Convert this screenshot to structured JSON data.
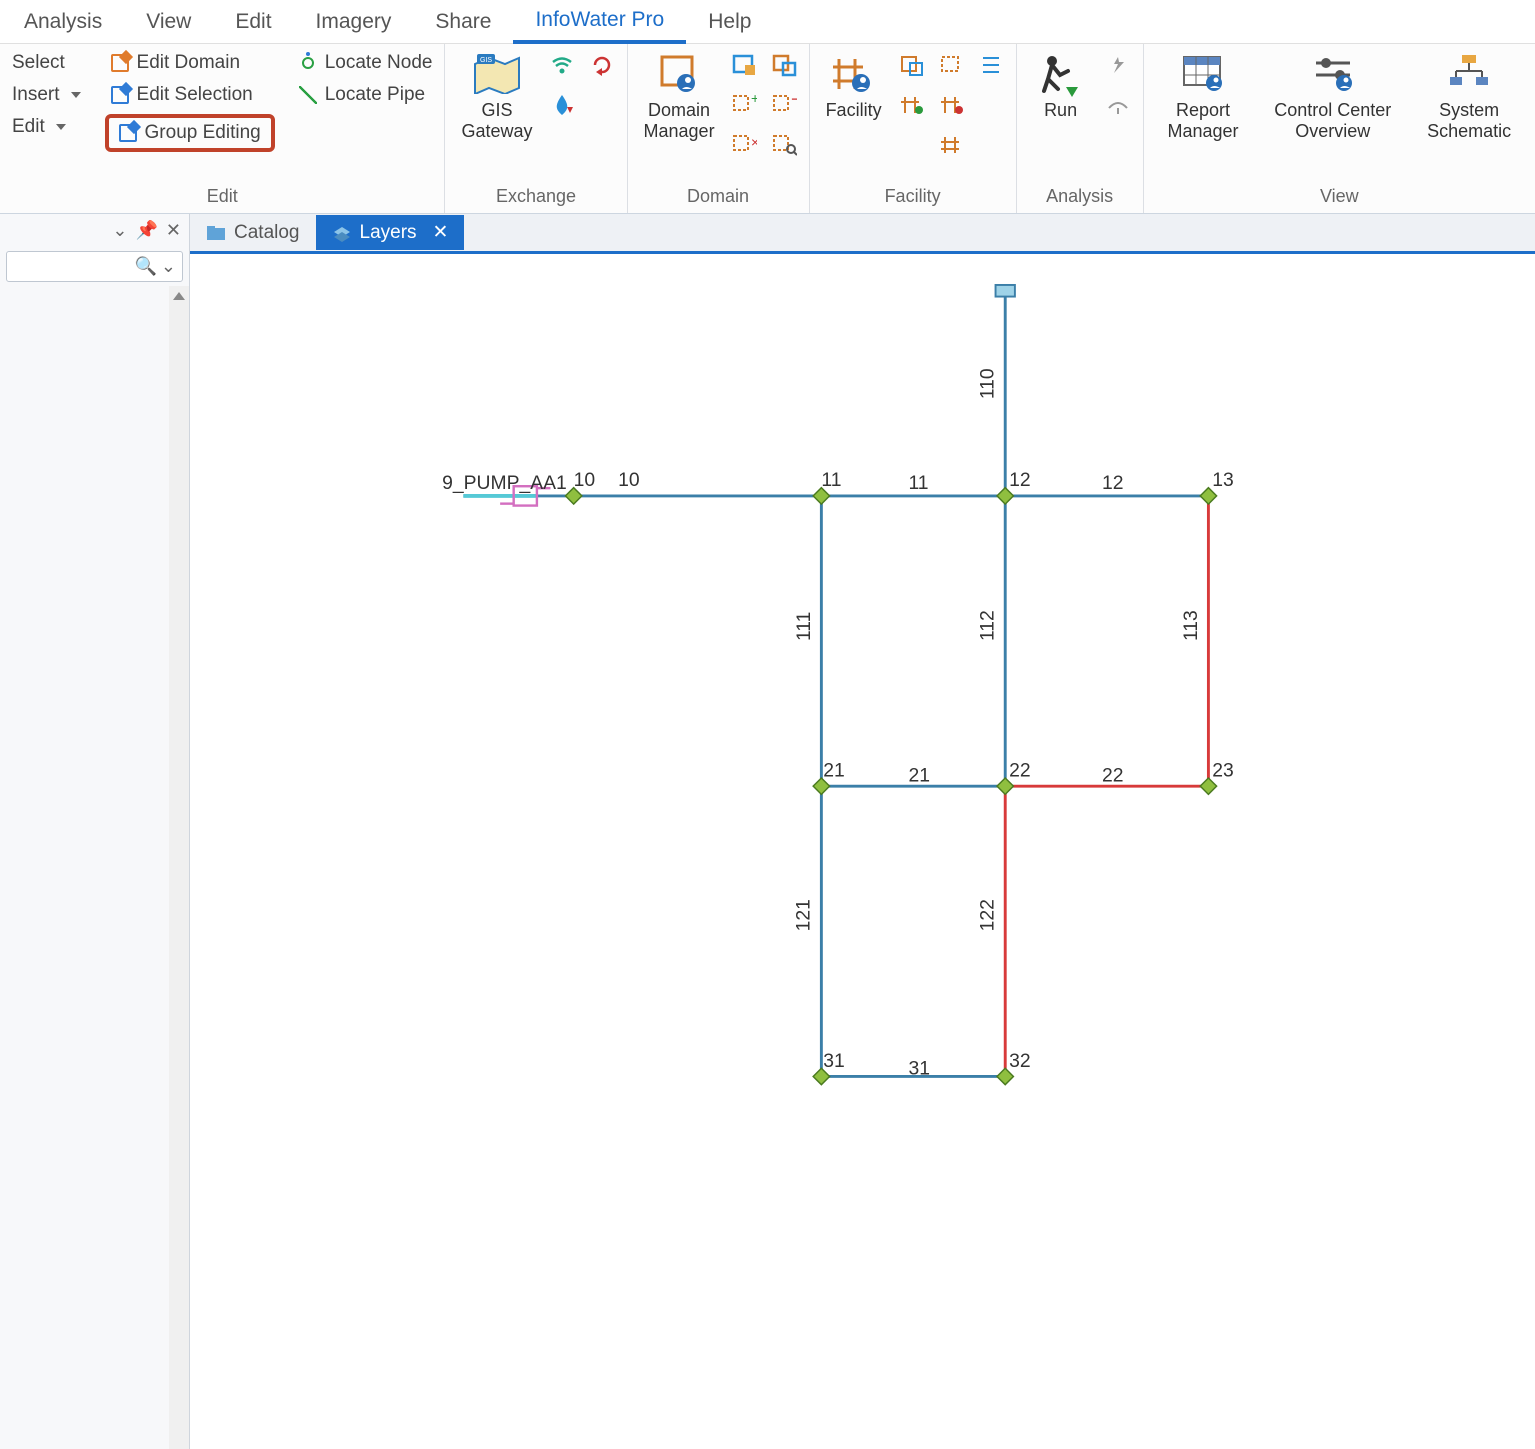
{
  "menu_tabs": {
    "analysis": "Analysis",
    "view": "View",
    "edit": "Edit",
    "imagery": "Imagery",
    "share": "Share",
    "infowater": "InfoWater Pro",
    "help": "Help"
  },
  "ribbon": {
    "edit_group": {
      "select": "Select",
      "insert": "Insert",
      "edit": "Edit",
      "edit_domain": "Edit Domain",
      "edit_selection": "Edit Selection",
      "group_editing": "Group Editing",
      "locate_node": "Locate Node",
      "locate_pipe": "Locate Pipe",
      "label": "Edit"
    },
    "exchange": {
      "gis_gateway": "GIS\nGateway",
      "label": "Exchange"
    },
    "domain": {
      "domain_manager": "Domain\nManager",
      "label": "Domain"
    },
    "facility": {
      "facility": "Facility",
      "label": "Facility"
    },
    "analysis": {
      "run": "Run",
      "label": "Analysis"
    },
    "view": {
      "report_manager": "Report\nManager",
      "control_center": "Control Center\nOverview",
      "system_schematic": "System\nSchematic",
      "label": "View"
    }
  },
  "doc_tabs": {
    "catalog": "Catalog",
    "layers": "Layers"
  },
  "side_panel": {
    "search_placeholder": ""
  },
  "network": {
    "pump_label": "9_PUMP_AA1",
    "nodes": {
      "n10a": "10",
      "n10b": "10",
      "n11": "11",
      "n12": "12",
      "n13": "13",
      "n21": "21",
      "n22": "22",
      "n23": "23",
      "n31": "31",
      "n32": "32"
    },
    "pipes": {
      "p110": "110",
      "p11": "11",
      "p12": "12",
      "p111": "111",
      "p112": "112",
      "p113": "113",
      "p21": "21",
      "p22": "22",
      "p121": "121",
      "p122": "122",
      "p31": "31"
    }
  }
}
